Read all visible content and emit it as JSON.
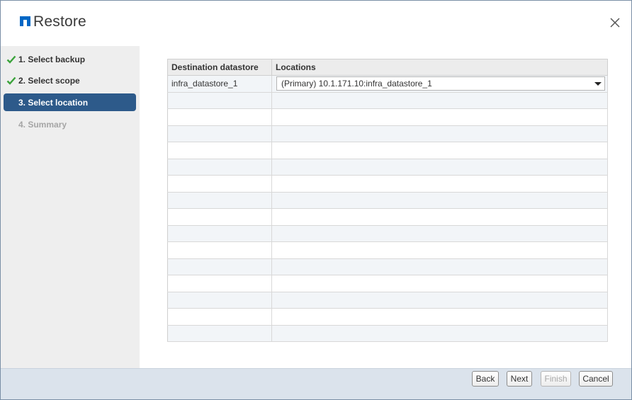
{
  "dialog": {
    "title": "Restore",
    "close_icon": "close-icon",
    "logo_icon": "netapp-logo-icon"
  },
  "steps": [
    {
      "label": "1. Select backup",
      "state": "done"
    },
    {
      "label": "2. Select scope",
      "state": "done"
    },
    {
      "label": "3. Select location",
      "state": "active"
    },
    {
      "label": "4. Summary",
      "state": "disabled"
    }
  ],
  "table": {
    "headers": [
      "Destination datastore",
      "Locations"
    ],
    "rows": [
      {
        "datastore": "infra_datastore_1",
        "location": "(Primary) 10.1.171.10:infra_datastore_1"
      }
    ],
    "empty_rows": 15
  },
  "footer": {
    "back_label": "Back",
    "next_label": "Next",
    "finish_label": "Finish",
    "cancel_label": "Cancel"
  },
  "colors": {
    "accent": "#2d5a8a",
    "check": "#3aa33a",
    "footer_bg": "#dbe3ec",
    "sidebar_bg": "#eeeeee"
  }
}
